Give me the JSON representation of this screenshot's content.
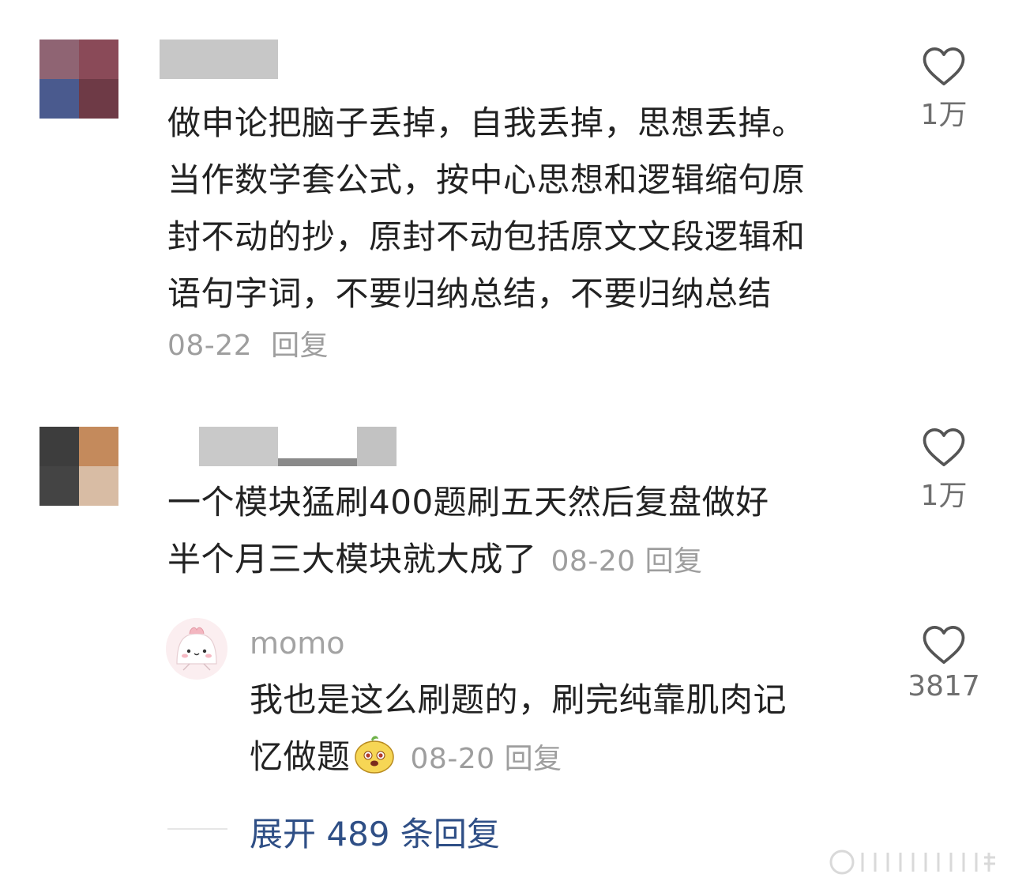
{
  "comments": [
    {
      "text_lines": [
        "做申论把脑子丢掉，自我丢掉，思想丢掉。",
        "当作数学套公式，按中心思想和逻辑缩句原",
        "封不动的抄，原封不动包括原文文段逻辑和",
        "语句字词，不要归纳总结，不要归纳总结"
      ],
      "date": "08-22",
      "reply_label": "回复",
      "like_count": "1万"
    },
    {
      "text_lines": [
        "一个模块猛刷400题刷五天然后复盘做好",
        "半个月三大模块就大成了"
      ],
      "date": "08-20",
      "reply_label": "回复",
      "like_count": "1万",
      "reply": {
        "username": "momo",
        "text_lines": [
          "我也是这么刷题的，刷完纯靠肌肉记",
          "忆做题"
        ],
        "date": "08-20",
        "reply_label": "回复",
        "like_count": "3817"
      },
      "expand_label": "展开 489 条回复"
    }
  ],
  "colors": {
    "text": "#222222",
    "meta": "#9e9e9e",
    "link": "#2f4f86",
    "heart": "#555555"
  }
}
